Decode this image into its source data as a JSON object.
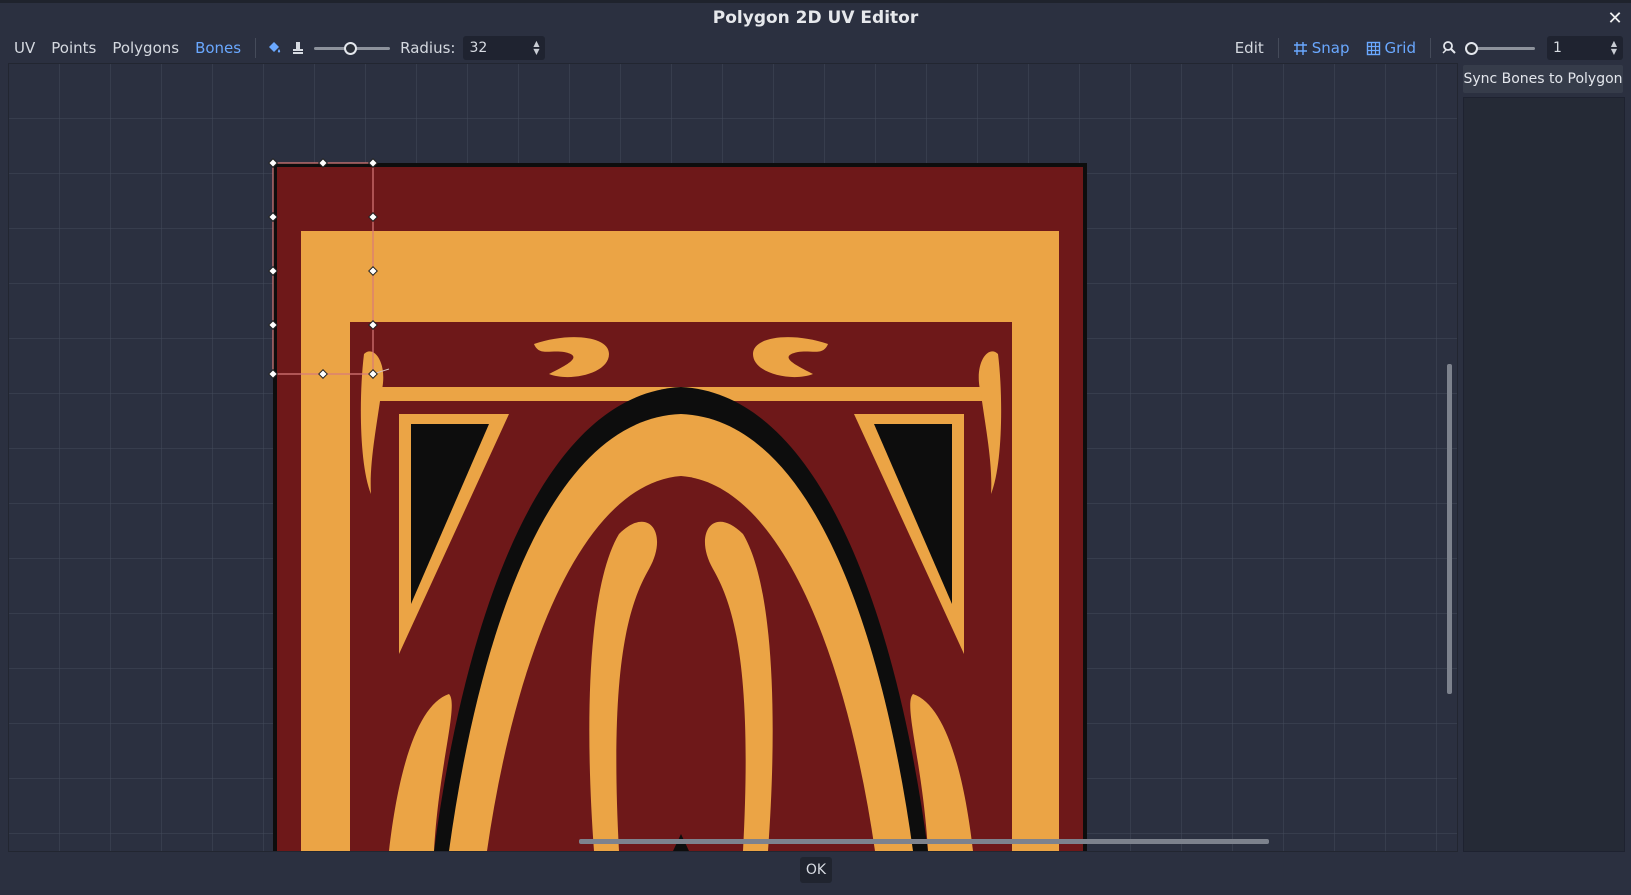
{
  "window": {
    "title": "Polygon 2D UV Editor",
    "close_symbol": "✕"
  },
  "toolbar": {
    "tabs": [
      {
        "label": "UV",
        "active": false
      },
      {
        "label": "Points",
        "active": false
      },
      {
        "label": "Polygons",
        "active": false
      },
      {
        "label": "Bones",
        "active": true
      }
    ],
    "paint_icon": "paint-bucket-icon",
    "erase_icon": "brush-icon",
    "radius_label": "Radius:",
    "radius_value": "32",
    "edit_label": "Edit",
    "snap_label": "Snap",
    "grid_label": "Grid",
    "zoom_icon": "zoom-reset-icon",
    "zoom_value": "1"
  },
  "side_panel": {
    "sync_button": "Sync Bones to Polygon"
  },
  "footer": {
    "ok_label": "OK"
  },
  "colors": {
    "accent": "#6aa8ff",
    "background": "#2b3040",
    "texture_red": "#6e1819",
    "texture_orange": "#eba445"
  }
}
